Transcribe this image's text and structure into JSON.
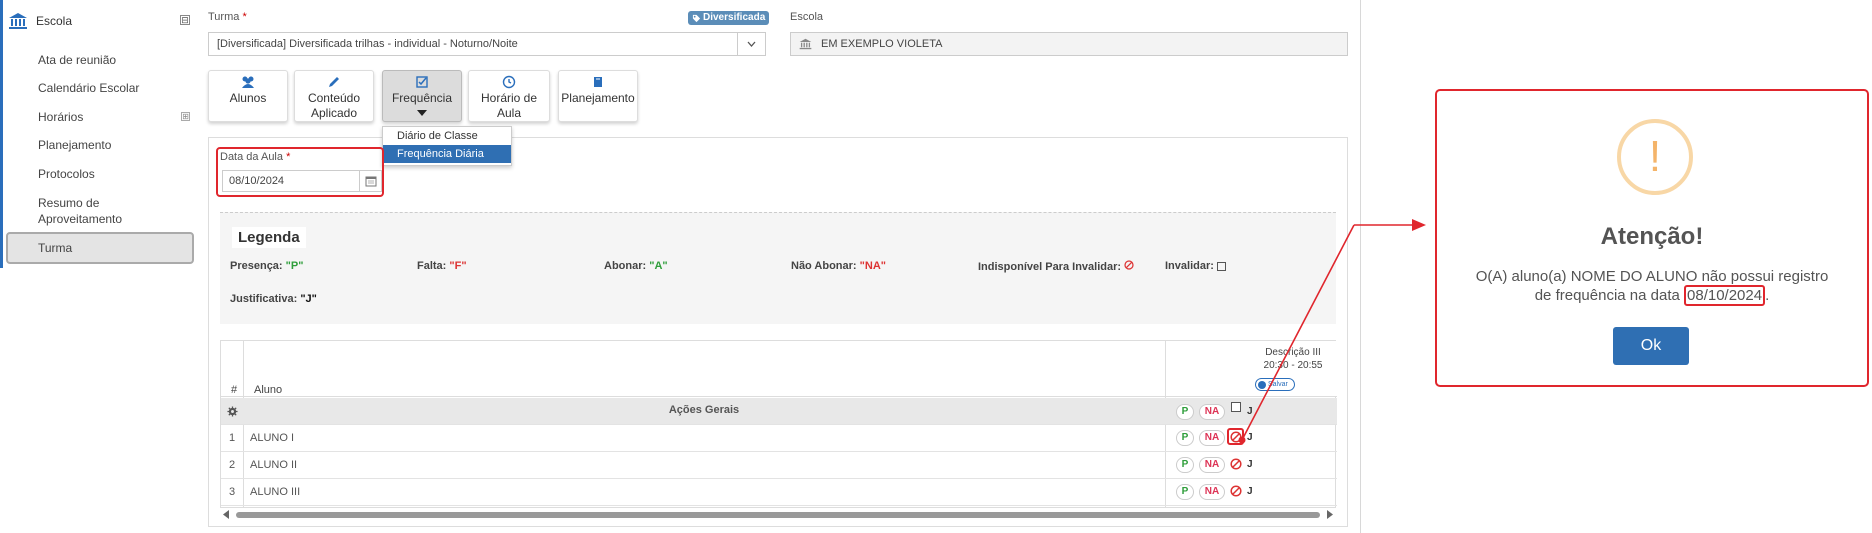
{
  "sidebar": {
    "header": "Escola",
    "collapse_symbol": "⊟",
    "items": [
      {
        "label": "Ata de reunião"
      },
      {
        "label": "Calendário Escolar"
      },
      {
        "label": "Horários",
        "expand": "⊞"
      },
      {
        "label": "Planejamento"
      },
      {
        "label": "Protocolos"
      },
      {
        "label": "Resumo de Aproveitamento"
      },
      {
        "label": "Turma"
      }
    ]
  },
  "form": {
    "turma_label": "Turma",
    "required_mark": "*",
    "badge": "Diversificada",
    "turma_value": "[Diversificada]  Diversificada trilhas - individual - Noturno/Noite",
    "escola_label": "Escola",
    "escola_value": "EM EXEMPLO VIOLETA"
  },
  "tabs": [
    {
      "label_1": "Alunos",
      "label_2": ""
    },
    {
      "label_1": "Conteúdo",
      "label_2": "Aplicado"
    },
    {
      "label_1": "Frequência",
      "label_2": ""
    },
    {
      "label_1": "Horário de",
      "label_2": "Aula"
    },
    {
      "label_1": "Planejamento",
      "label_2": ""
    }
  ],
  "dropdown": {
    "items": [
      "Diário de Classe",
      "Frequência Diária"
    ],
    "selected": "Frequência Diária"
  },
  "date": {
    "label": "Data da Aula",
    "value": "08/10/2024"
  },
  "legend": {
    "title": "Legenda",
    "presenca": {
      "label": "Presença:",
      "code": "\"P\""
    },
    "falta": {
      "label": "Falta:",
      "code": "\"F\""
    },
    "abonar": {
      "label": "Abonar:",
      "code": "\"A\""
    },
    "nao_abonar": {
      "label": "Não Abonar:",
      "code": "\"NA\""
    },
    "indisponivel": {
      "label": "Indisponível Para Invalidar:"
    },
    "invalidar": {
      "label": "Invalidar:"
    },
    "justificativa": {
      "label": "Justificativa:",
      "code": "\"J\""
    }
  },
  "table": {
    "col_num": "#",
    "col_aluno": "Aluno",
    "col_desc_1": "Descrição III",
    "col_desc_2": "20:30 - 20:55",
    "salvar": "Salvar",
    "acoes_gerais": "Ações Gerais",
    "pill_p": "P",
    "pill_na": "NA",
    "pill_j": "J",
    "rows": [
      {
        "num": "1",
        "name": "ALUNO I"
      },
      {
        "num": "2",
        "name": "ALUNO II"
      },
      {
        "num": "3",
        "name": "ALUNO III"
      }
    ]
  },
  "modal": {
    "icon": "!",
    "title": "Atenção!",
    "msg_part1": "O(A) aluno(a) NOME DO ALUNO não possui registro de frequência na data",
    "msg_date": "08/10/2024",
    "msg_end": ".",
    "ok": "Ok"
  },
  "colors": {
    "accent": "#2f6fb3",
    "highlight": "#e0262d",
    "present": "#2e9e3a",
    "absent": "#d33333"
  }
}
